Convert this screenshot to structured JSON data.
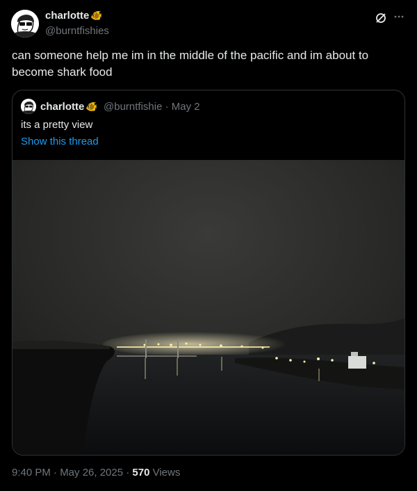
{
  "author": {
    "name": "charlotte",
    "emoji": "🐠",
    "handle": "@burntfishies"
  },
  "tweet": {
    "text": "can someone help me im in the middle of the pacific and im about to become shark food"
  },
  "quoted": {
    "name": "charlotte",
    "emoji": "🐠",
    "handle": "@burntfishie",
    "date": "· May 2",
    "text": "its a pretty view",
    "link": "Show this thread"
  },
  "footer": {
    "time": "9:40 PM · May 26, 2025 · ",
    "views_count": "570",
    "views_label": " Views"
  },
  "icons": {
    "grok": "grok-icon",
    "more": "more-icon"
  },
  "colors": {
    "accent": "#1d9bf0",
    "secondary": "#71767b",
    "background": "#000000"
  }
}
